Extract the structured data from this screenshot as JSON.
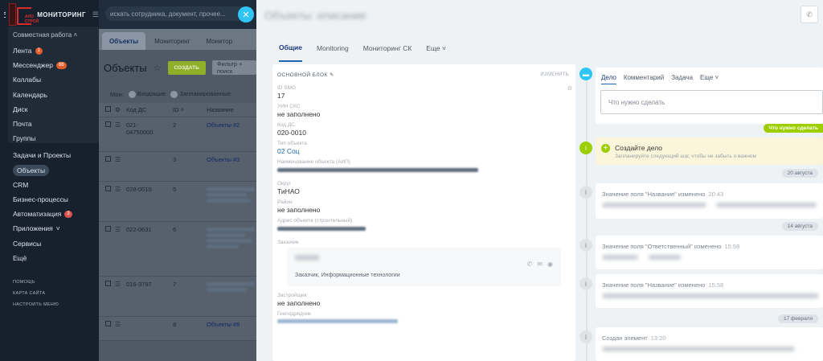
{
  "app": {
    "name": "МОНИТОРИНГ",
    "logo_text": "АНО СТРОЙ"
  },
  "search": {
    "placeholder": "искать сотрудника, документ, прочее..."
  },
  "sidebar": {
    "group_title": "Совместная работа",
    "sub_items": [
      {
        "label": "Лента",
        "badge": "1"
      },
      {
        "label": "Мессенджер",
        "badge": "66"
      },
      {
        "label": "Коллабы"
      },
      {
        "label": "Календарь"
      },
      {
        "label": "Диск"
      },
      {
        "label": "Почта"
      },
      {
        "label": "Группы"
      }
    ],
    "items": [
      {
        "label": "Задачи и Проекты"
      },
      {
        "label": "Объекты",
        "active": true
      },
      {
        "label": "CRM"
      },
      {
        "label": "Бизнес-процессы"
      },
      {
        "label": "Автоматизация",
        "badge": "3"
      },
      {
        "label": "Приложения"
      },
      {
        "label": "Сервисы"
      },
      {
        "label": "Ещё"
      }
    ],
    "footer": [
      "ПОМОЩЬ",
      "КАРТА САЙТА",
      "НАСТРОИТЬ МЕНЮ"
    ]
  },
  "list_page": {
    "tabs": [
      "Объекты",
      "Мониторинг",
      "Монитор"
    ],
    "title": "Объекты",
    "create_label": "СОЗДАТЬ",
    "filter_placeholder": "Фильтр + поиск",
    "chips": {
      "my": "Мои:",
      "incoming_count": "0",
      "incoming": "Входящие",
      "planned_count": "0",
      "planned": "Запланированные"
    },
    "columns": {
      "code": "Код ДС",
      "id": "ID",
      "name": "Название"
    },
    "rows": [
      {
        "code": "021-04750000",
        "id": "2",
        "name": "Объекты #2"
      },
      {
        "code": "",
        "id": "3",
        "name": "Объекты #3"
      },
      {
        "code": "028-0010",
        "id": "5",
        "name": ""
      },
      {
        "code": "022-0631",
        "id": "6",
        "name": ""
      },
      {
        "code": "016-3797",
        "id": "7",
        "name": ""
      },
      {
        "code": "",
        "id": "8",
        "name": "Объекты #8"
      }
    ]
  },
  "detail": {
    "title": "Объекты: описание",
    "tabs": [
      "Общие",
      "Monitoring",
      "Мониторинг СК",
      "Еще"
    ],
    "block_title": "ОСНОВНОЙ БЛОК",
    "block_edit": "ИЗМЕНИТЬ",
    "fields": [
      {
        "label": "ID SMG",
        "value": "17"
      },
      {
        "label": "УИН СКС",
        "value": "не заполнено"
      },
      {
        "label": "Код ДС",
        "value": "020-0010"
      },
      {
        "label": "Тип объекта",
        "value": "02 Соц",
        "link": true
      },
      {
        "label": "Наименование объекта (АИП)",
        "value": ""
      },
      {
        "label": "Округ",
        "value": "ТиНАО"
      },
      {
        "label": "Район",
        "value": "не заполнено"
      },
      {
        "label": "Адрес объекта (строительный)",
        "value": ""
      },
      {
        "label": "Заказчик",
        "value": ""
      }
    ],
    "contact": {
      "role": "Заказчик, Информационные технологии"
    },
    "more_fields": [
      {
        "label": "Застройщик",
        "value": "не заполнено"
      },
      {
        "label": "Генподрядчик",
        "value": ""
      }
    ]
  },
  "timeline": {
    "activity_tabs": [
      "Дело",
      "Комментарий",
      "Задача",
      "Еще"
    ],
    "input_placeholder": "Что нужно сделать",
    "need_badge": "Что нужно сделать",
    "todo": {
      "title": "Создайте дело",
      "subtitle": "Запланируйте следующий шаг, чтобы не забыть о важном"
    },
    "dates": [
      "20 августа",
      "14 августа",
      "17 февраля"
    ],
    "events": [
      {
        "title": "Значение поля \"Название\" изменено",
        "time": "20:43"
      },
      {
        "title": "Значение поля \"Ответственный\" изменено",
        "time": "15:58"
      },
      {
        "title": "Значение поля \"Название\" изменено",
        "time": "15:58"
      },
      {
        "title": "Создан элемент",
        "time": "13:20"
      }
    ]
  }
}
